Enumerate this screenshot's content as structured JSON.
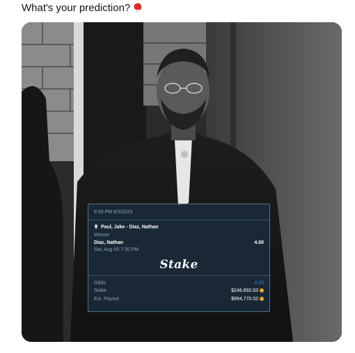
{
  "post": {
    "text": "What's your prediction?",
    "emoji_icon": "boxing-glove-icon"
  },
  "bet_slip": {
    "timestamp": "8:59 PM 8/3/2023",
    "event": "Paul, Jake - Diaz, Nathan",
    "market": "Winner",
    "selection": "Diaz, Nathan",
    "selection_odds": "4.00",
    "event_date": "Sat, Aug 05 7:30 PM",
    "brand": "Stake",
    "odds_label": "Odds",
    "odds_value": "4.00",
    "stake_label": "Stake",
    "stake_value": "$248,692.63",
    "payout_label": "Est. Payout",
    "payout_value": "$994,770.52",
    "currency_icon": "coin-icon"
  },
  "colors": {
    "odds_accent": "#2f8cf0",
    "coin": "#f7a21b",
    "slip_bg": "#1b2a38"
  }
}
